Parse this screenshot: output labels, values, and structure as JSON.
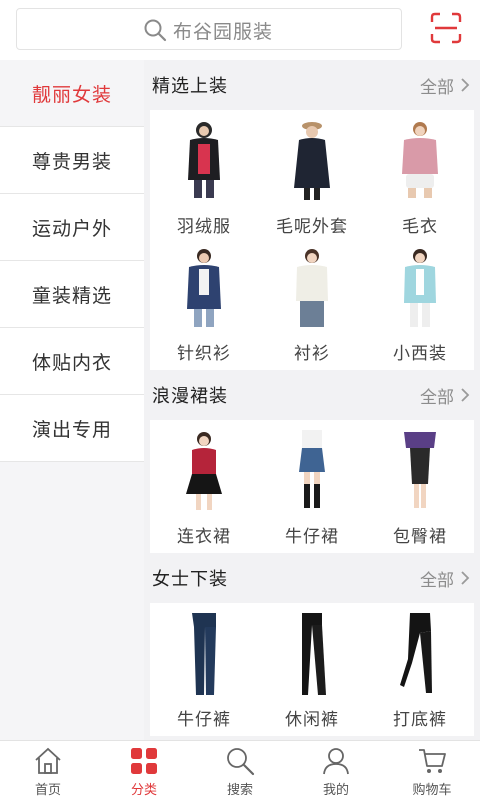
{
  "search": {
    "placeholder": "布谷园服装"
  },
  "colors": {
    "accent": "#e0393b",
    "text": "#333333",
    "muted": "#8c8c8c"
  },
  "sidebar": {
    "items": [
      {
        "label": "靓丽女装",
        "active": true
      },
      {
        "label": "尊贵男装"
      },
      {
        "label": "运动户外"
      },
      {
        "label": "童装精选"
      },
      {
        "label": "体贴内衣"
      },
      {
        "label": "演出专用"
      }
    ]
  },
  "sections": [
    {
      "title": "精选上装",
      "all_label": "全部",
      "items": [
        {
          "label": "羽绒服"
        },
        {
          "label": "毛呢外套"
        },
        {
          "label": "毛衣"
        },
        {
          "label": "针织衫"
        },
        {
          "label": "衬衫"
        },
        {
          "label": "小西装"
        }
      ]
    },
    {
      "title": "浪漫裙装",
      "all_label": "全部",
      "items": [
        {
          "label": "连衣裙"
        },
        {
          "label": "牛仔裙"
        },
        {
          "label": "包臀裙"
        }
      ]
    },
    {
      "title": "女士下装",
      "all_label": "全部",
      "items": [
        {
          "label": "牛仔裤"
        },
        {
          "label": "休闲裤"
        },
        {
          "label": "打底裤"
        }
      ]
    }
  ],
  "tabbar": {
    "items": [
      {
        "label": "首页",
        "icon": "home-icon"
      },
      {
        "label": "分类",
        "icon": "category-grid-icon",
        "active": true
      },
      {
        "label": "搜索",
        "icon": "search-icon"
      },
      {
        "label": "我的",
        "icon": "user-icon"
      },
      {
        "label": "购物车",
        "icon": "cart-icon"
      }
    ]
  }
}
